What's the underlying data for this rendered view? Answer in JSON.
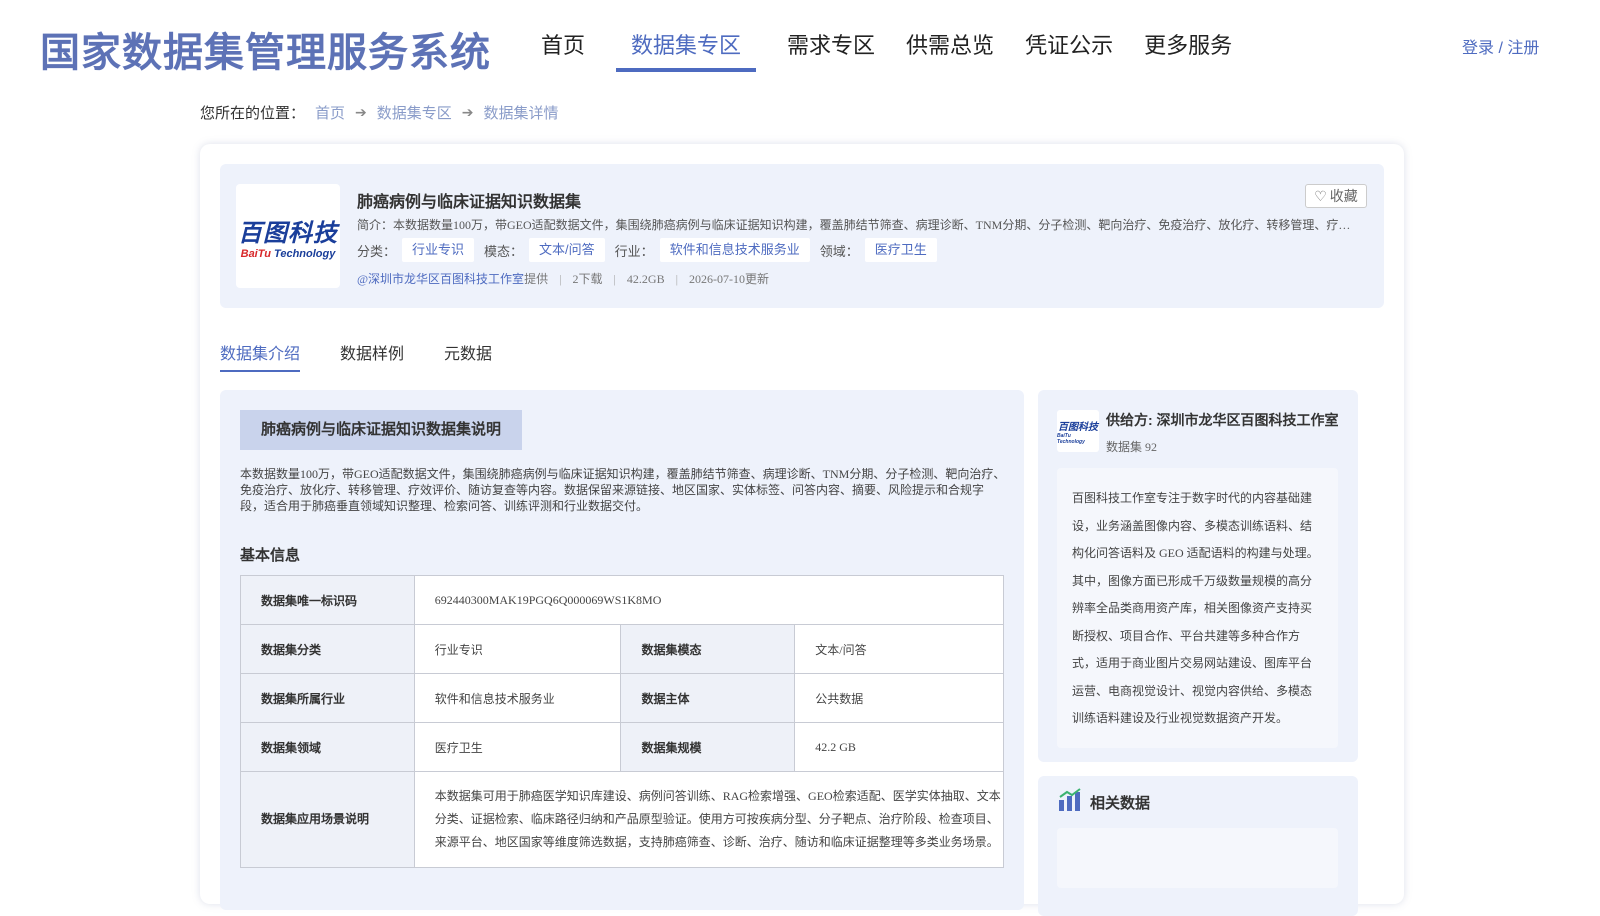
{
  "header": {
    "logo": "国家数据集管理服务系统",
    "nav": [
      "首页",
      "数据集专区",
      "需求专区",
      "供需总览",
      "凭证公示",
      "更多服务"
    ],
    "active_nav": "数据集专区",
    "login": "登录 / 注册"
  },
  "breadcrumb": {
    "prefix": "您所在的位置：",
    "items": [
      "首页",
      "数据集专区",
      "数据集详情"
    ]
  },
  "dataset": {
    "logo_cn": "百图科技",
    "logo_en_a": "BaiTu",
    "logo_en_b": " Technology",
    "title": "肺癌病例与临床证据知识数据集",
    "intro": "简介：本数据数量100万，带GEO适配数据文件，集围绕肺癌病例与临床证据知识构建，覆盖肺结节筛查、病理诊断、TNM分期、分子检测、靶向治疗、免疫治疗、放化疗、转移管理、疗效评价、随访复查等内容。",
    "favorite": "收藏",
    "tags": [
      {
        "key": "分类：",
        "value": "行业专识"
      },
      {
        "key": "模态：",
        "value": "文本/问答"
      },
      {
        "key": "行业：",
        "value": "软件和信息技术服务业"
      },
      {
        "key": "领域：",
        "value": "医疗卫生"
      }
    ],
    "provider": "@深圳市龙华区百图科技工作室",
    "provided": "提供",
    "downloads": "2下载",
    "size": "42.2GB",
    "updated": "2026-07-10更新"
  },
  "tabs": [
    "数据集介绍",
    "数据样例",
    "元数据"
  ],
  "intro_section": {
    "title": "肺癌病例与临床证据知识数据集说明",
    "description": "本数据数量100万，带GEO适配数据文件，集围绕肺癌病例与临床证据知识构建，覆盖肺结节筛查、病理诊断、TNM分期、分子检测、靶向治疗、免疫治疗、放化疗、转移管理、疗效评价、随访复查等内容。数据保留来源链接、地区国家、实体标签、问答内容、摘要、风险提示和合规字段，适合用于肺癌垂直领域知识整理、检索问答、训练评测和行业数据交付。",
    "basic_title": "基本信息",
    "table": {
      "id_label": "数据集唯一标识码",
      "id_value": "692440300MAK19PGQ6Q000069WS1K8MO",
      "rows": [
        {
          "k1": "数据集分类",
          "v1": "行业专识",
          "k2": "数据集模态",
          "v2": "文本/问答"
        },
        {
          "k1": "数据集所属行业",
          "v1": "软件和信息技术服务业",
          "k2": "数据主体",
          "v2": "公共数据"
        },
        {
          "k1": "数据集领域",
          "v1": "医疗卫生",
          "k2": "数据集规模",
          "v2": "42.2 GB"
        }
      ],
      "scene_label": "数据集应用场景说明",
      "scene_value": "本数据集可用于肺癌医学知识库建设、病例问答训练、RAG检索增强、GEO检索适配、医学实体抽取、文本分类、证据检索、临床路径归纳和产品原型验证。使用方可按疾病分型、分子靶点、治疗阶段、检查项目、来源平台、地区国家等维度筛选数据，支持肺癌筛查、诊断、治疗、随访和临床证据整理等多类业务场景。"
    }
  },
  "supplier": {
    "logo_cn": "百图科技",
    "logo_en": "BaiTu Technology",
    "name": "供给方: 深圳市龙华区百图科技工作室",
    "count": "数据集 92",
    "description": "百图科技工作室专注于数字时代的内容基础建设，业务涵盖图像内容、多模态训练语料、结构化问答语料及 GEO 适配语料的构建与处理。其中，图像方面已形成千万级数量规模的高分辨率全品类商用资产库，相关图像资产支持买断授权、项目合作、平台共建等多种合作方式，适用于商业图片交易网站建设、图库平台运营、电商视觉设计、视觉内容供给、多模态训练语料建设及行业视觉数据资产开发。"
  },
  "related": {
    "title": "相关数据"
  },
  "colors": {
    "accent": "#4e6bc0",
    "logo": "#5d72b6",
    "panel": "#eef2fb"
  }
}
